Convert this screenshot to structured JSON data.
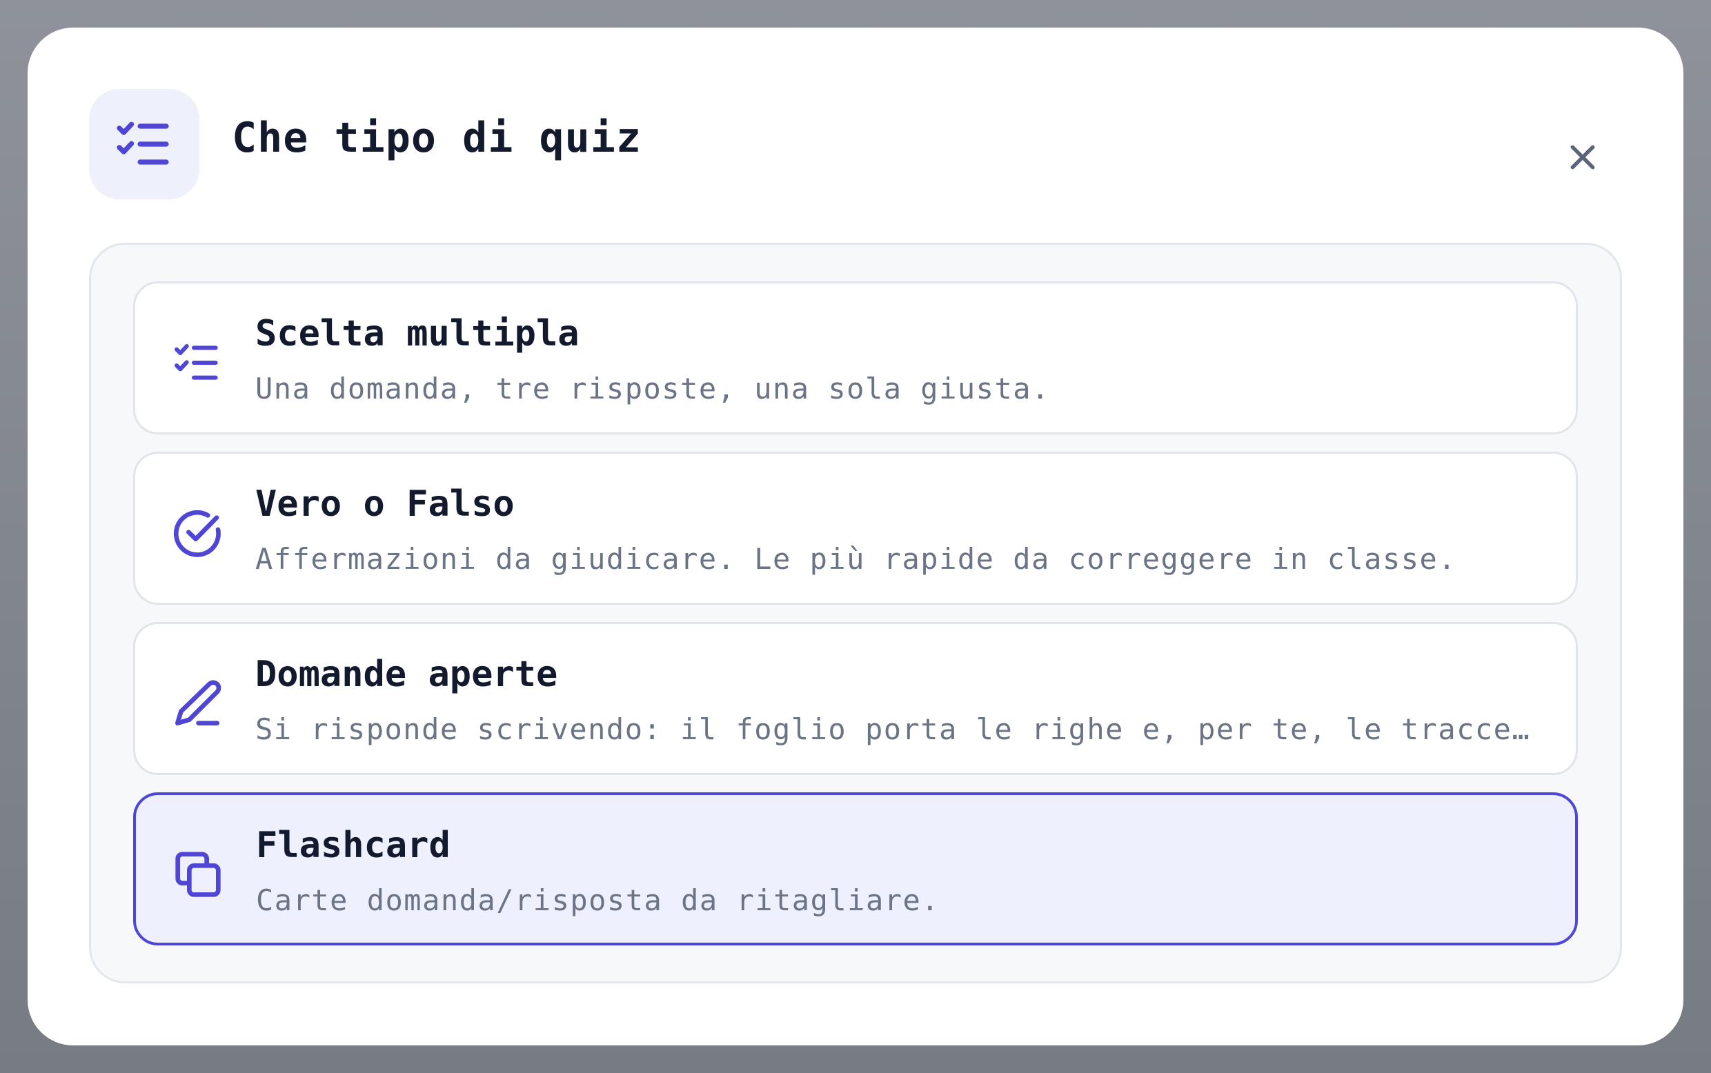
{
  "dialog": {
    "title": "Che tipo di quiz",
    "header_icon": "checklist-icon",
    "close_icon": "close-icon"
  },
  "options": [
    {
      "title": "Scelta multipla",
      "description": "Una domanda, tre risposte, una sola giusta.",
      "icon": "checklist-icon",
      "selected": false
    },
    {
      "title": "Vero o Falso",
      "description": "Affermazioni da giudicare. Le più rapide da correggere in classe.",
      "icon": "circle-check-icon",
      "selected": false
    },
    {
      "title": "Domande aperte",
      "description": "Si risponde scrivendo: il foglio porta le righe e, per te, le tracce…",
      "icon": "pen-icon",
      "selected": false
    },
    {
      "title": "Flashcard",
      "description": "Carte domanda/risposta da ritagliare.",
      "icon": "copy-cards-icon",
      "selected": true
    }
  ],
  "colors": {
    "accent": "#4f46d6",
    "selected_background": "#eef0fd",
    "title_text": "#141a2e",
    "description_text": "#6b7386",
    "icon_tile_background": "#eef0fc"
  }
}
